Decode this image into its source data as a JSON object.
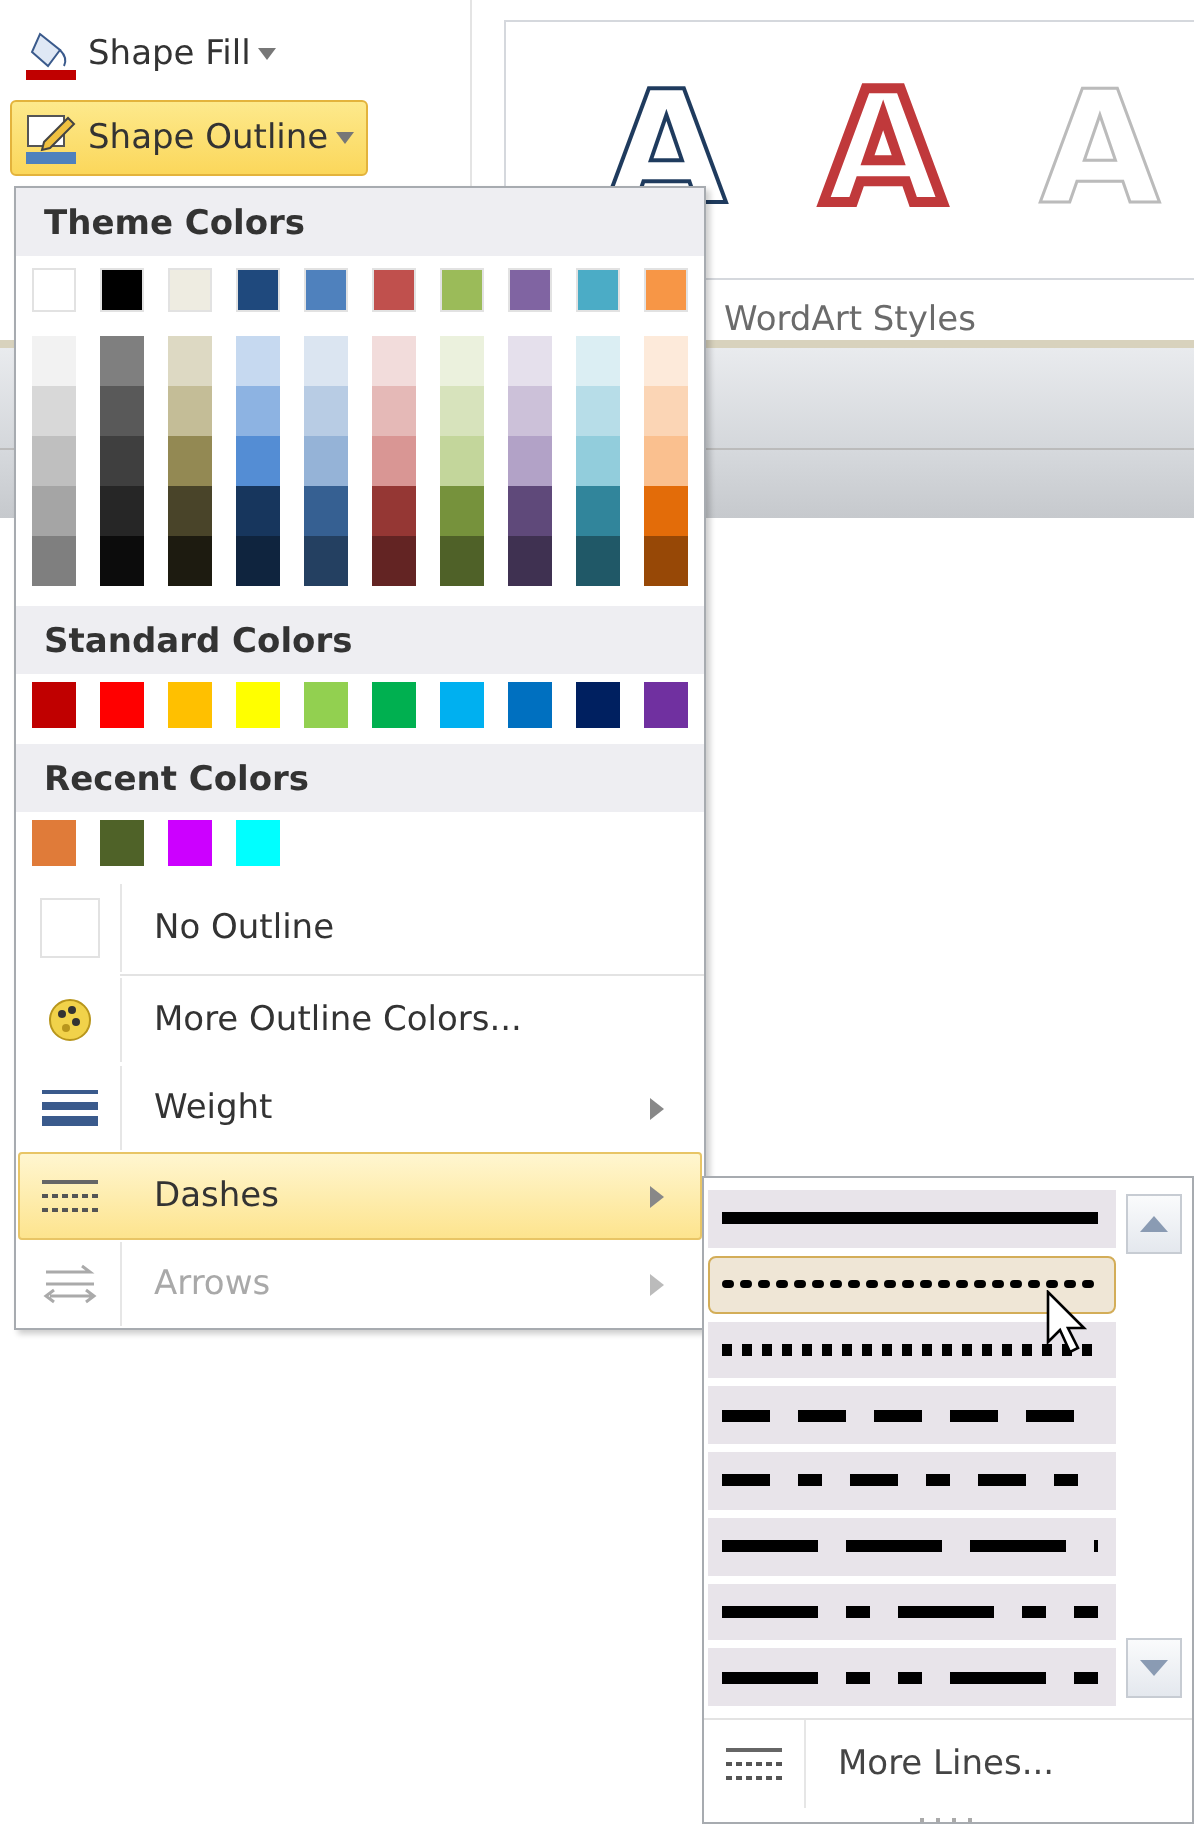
{
  "ribbon": {
    "buttons": [
      {
        "kind": "fill",
        "label": "Shape Fill",
        "selected": false
      },
      {
        "kind": "outline",
        "label": "Shape Outline",
        "selected": true
      }
    ],
    "wordart_gallery": {
      "items": [
        {
          "kind": "blue-outline",
          "letter": "A"
        },
        {
          "kind": "red-outline",
          "letter": "A"
        },
        {
          "kind": "gray-outline",
          "letter": "A"
        }
      ],
      "label": "WordArt Styles"
    }
  },
  "outline_menu": {
    "theme_colors": {
      "title": "Theme Colors",
      "columns": [
        {
          "color": "#ffffff",
          "shades": [
            {
              "color": "#f2f2f2"
            },
            {
              "color": "#d8d8d8"
            },
            {
              "color": "#bfbfbf"
            },
            {
              "color": "#a5a5a5"
            },
            {
              "color": "#7f7f7f"
            }
          ]
        },
        {
          "color": "#000000",
          "shades": [
            {
              "color": "#7f7f7f"
            },
            {
              "color": "#595959"
            },
            {
              "color": "#3f3f3f"
            },
            {
              "color": "#262626"
            },
            {
              "color": "#0c0c0c"
            }
          ]
        },
        {
          "color": "#eeece1",
          "shades": [
            {
              "color": "#ddd9c3"
            },
            {
              "color": "#c4bd97"
            },
            {
              "color": "#938953"
            },
            {
              "color": "#494429"
            },
            {
              "color": "#1d1b10"
            }
          ]
        },
        {
          "color": "#1f497d",
          "shades": [
            {
              "color": "#c6d9f0"
            },
            {
              "color": "#8db3e2"
            },
            {
              "color": "#548dd4"
            },
            {
              "color": "#17365d"
            },
            {
              "color": "#0f243e"
            }
          ]
        },
        {
          "color": "#4f81bd",
          "shades": [
            {
              "color": "#dbe5f1"
            },
            {
              "color": "#b8cce4"
            },
            {
              "color": "#95b3d7"
            },
            {
              "color": "#366092"
            },
            {
              "color": "#244061"
            }
          ]
        },
        {
          "color": "#c0504d",
          "shades": [
            {
              "color": "#f2dcdb"
            },
            {
              "color": "#e5b9b7"
            },
            {
              "color": "#d99694"
            },
            {
              "color": "#953734"
            },
            {
              "color": "#632423"
            }
          ]
        },
        {
          "color": "#9bbb59",
          "shades": [
            {
              "color": "#ebf1dd"
            },
            {
              "color": "#d7e3bc"
            },
            {
              "color": "#c3d69b"
            },
            {
              "color": "#76923c"
            },
            {
              "color": "#4f6128"
            }
          ]
        },
        {
          "color": "#8064a2",
          "shades": [
            {
              "color": "#e5e0ec"
            },
            {
              "color": "#ccc1d9"
            },
            {
              "color": "#b2a2c7"
            },
            {
              "color": "#5f497a"
            },
            {
              "color": "#3f3151"
            }
          ]
        },
        {
          "color": "#4bacc6",
          "shades": [
            {
              "color": "#dbeef3"
            },
            {
              "color": "#b7dde8"
            },
            {
              "color": "#92cddc"
            },
            {
              "color": "#31859b"
            },
            {
              "color": "#205867"
            }
          ]
        },
        {
          "color": "#f79646",
          "shades": [
            {
              "color": "#fdeada"
            },
            {
              "color": "#fbd5b5"
            },
            {
              "color": "#fac08f"
            },
            {
              "color": "#e36c09"
            },
            {
              "color": "#974806"
            }
          ]
        }
      ]
    },
    "standard_colors": {
      "title": "Standard Colors",
      "swatches": [
        {
          "color": "#c00000"
        },
        {
          "color": "#ff0000"
        },
        {
          "color": "#ffc000"
        },
        {
          "color": "#ffff00"
        },
        {
          "color": "#92d050"
        },
        {
          "color": "#00b050"
        },
        {
          "color": "#00b0f0"
        },
        {
          "color": "#0070c0"
        },
        {
          "color": "#002060"
        },
        {
          "color": "#7030a0"
        }
      ]
    },
    "recent_colors": {
      "title": "Recent Colors",
      "swatches": [
        {
          "color": "#e07b39"
        },
        {
          "color": "#4f6228"
        },
        {
          "color": "#cc00ff"
        },
        {
          "color": "#00ffff"
        }
      ]
    },
    "items": [
      {
        "kind": "none",
        "label": "No Outline",
        "highlighted": false,
        "disabled": false,
        "submenu": false
      },
      {
        "kind": "palette",
        "label": "More Outline Colors...",
        "highlighted": false,
        "disabled": false,
        "submenu": false
      },
      {
        "kind": "weight",
        "label": "Weight",
        "highlighted": false,
        "disabled": false,
        "submenu": true
      },
      {
        "kind": "dashes",
        "label": "Dashes",
        "highlighted": true,
        "disabled": false,
        "submenu": true
      },
      {
        "kind": "arrows",
        "label": "Arrows",
        "highlighted": false,
        "disabled": true,
        "submenu": true
      }
    ]
  },
  "dashes_menu": {
    "styles": [
      {
        "kind": "solid",
        "selected": false
      },
      {
        "kind": "round-dot",
        "selected": true
      },
      {
        "kind": "square-dot",
        "selected": false
      },
      {
        "kind": "dash",
        "selected": false
      },
      {
        "kind": "dash-dot",
        "selected": false
      },
      {
        "kind": "long-dash",
        "selected": false
      },
      {
        "kind": "long-dash-dot",
        "selected": false
      },
      {
        "kind": "long-dash-dot-dot",
        "selected": false
      }
    ],
    "more": "More Lines..."
  }
}
